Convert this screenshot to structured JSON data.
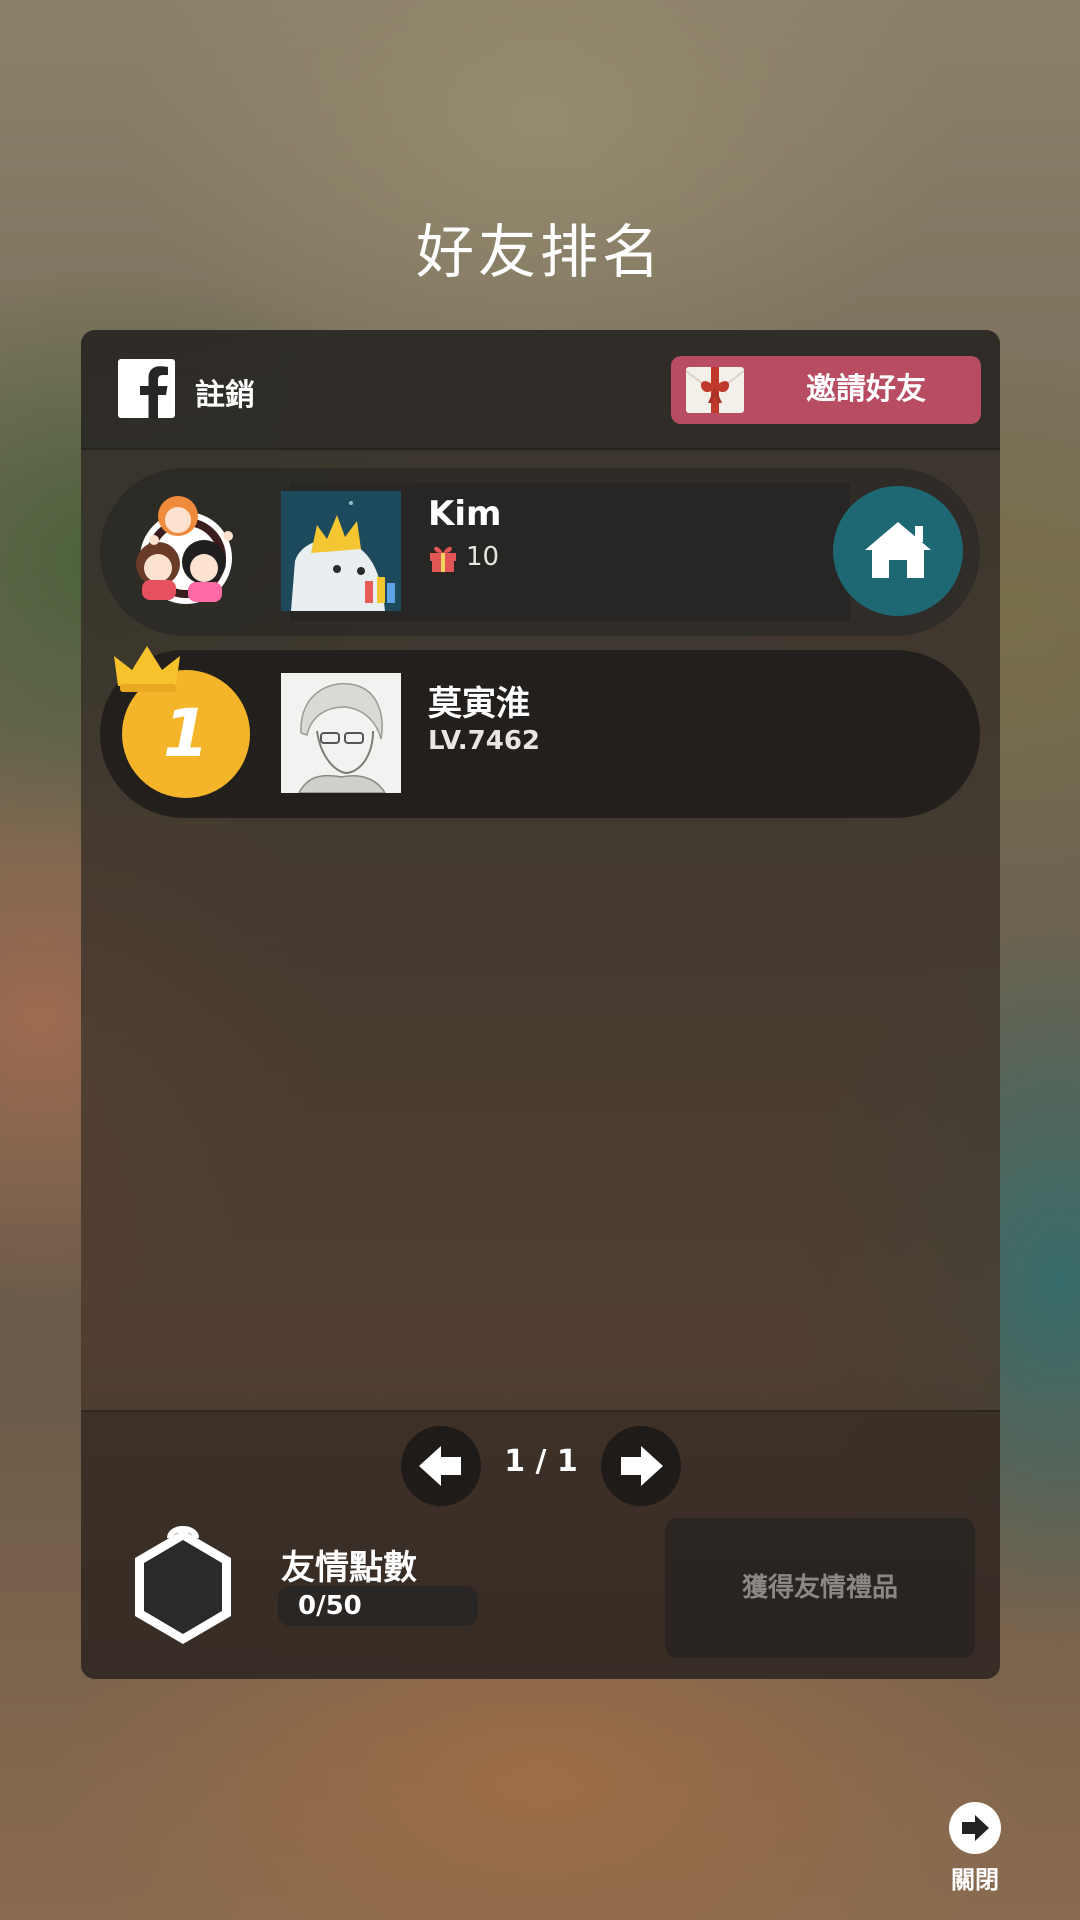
{
  "screen": {
    "title": "好友排名"
  },
  "header": {
    "logout_label": "註銷",
    "invite_label": "邀請好友"
  },
  "my_row": {
    "name": "Kim",
    "gift_count": "10"
  },
  "ranking": [
    {
      "rank": "1",
      "name": "莫寅淮",
      "level": "LV.7462"
    }
  ],
  "pagination": {
    "page_label": "1 / 1"
  },
  "friendship": {
    "label": "友情點數",
    "value": "0/50",
    "claim_label": "獲得友情禮品"
  },
  "close": {
    "label": "關閉"
  },
  "colors": {
    "invite_button": "#b84c63",
    "home_button": "#1e6874",
    "rank_gold": "#f5b52a"
  },
  "icons": [
    "facebook-icon",
    "envelope-icon",
    "gift-icon",
    "home-icon",
    "crown-icon",
    "arrow-left-icon",
    "arrow-right-icon",
    "close-arrow-icon"
  ]
}
